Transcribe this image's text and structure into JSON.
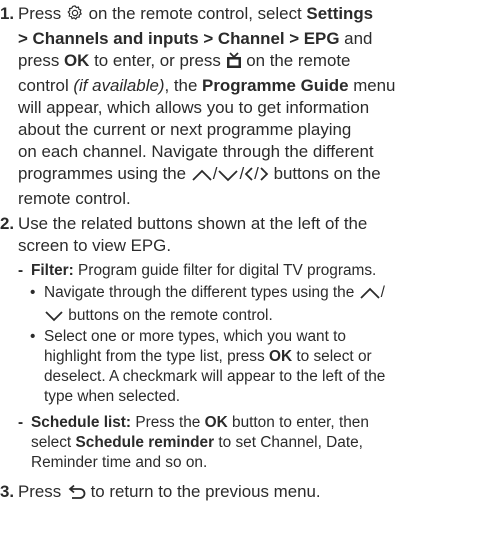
{
  "steps": [
    {
      "number": "1.",
      "lines": {
        "l1_a": "Press",
        "l1_b": "on the remote control, select",
        "l1_c": "Settings",
        "l2_a": "> Channels and inputs > Channel > EPG",
        "l2_b": "and",
        "l3_a": "press",
        "l3_b": "OK",
        "l3_c": "to enter, or press",
        "l3_d": "on the remote",
        "l4_a": "control",
        "l4_b": "(if available)",
        "l4_c": ", the",
        "l4_d": "Programme Guide",
        "l4_e": "menu",
        "l5": "will appear, which allows you to get information",
        "l6": "about the current or next programme playing",
        "l7": "on each channel. Navigate through the different",
        "l8_a": "programmes using the",
        "l8_b": "buttons on the",
        "l9": "remote control."
      }
    },
    {
      "number": "2.",
      "lines": {
        "l1": "Use the related buttons shown at the left of the",
        "l2": "screen to view EPG."
      },
      "filter": {
        "dash": "-",
        "label": "Filter:",
        "text": "Program guide filter for digital TV programs.",
        "bullets": {
          "b1_l1": "Navigate through the different types using the",
          "b1_l2": "buttons on the remote control.",
          "b2_l1": "Select one or more types, which you want to",
          "b2_l2_a": "highlight from the type list, press",
          "b2_l2_b": "OK",
          "b2_l2_c": "to select or",
          "b2_l3": "deselect. A checkmark will appear to the left of the",
          "b2_l4": "type when selected."
        },
        "bullet_char": "•"
      },
      "schedule": {
        "dash": "-",
        "label": "Schedule list:",
        "l1_a": "Press the",
        "l1_b": "OK",
        "l1_c": "button to enter, then",
        "l2_a": "select",
        "l2_b": "Schedule reminder",
        "l2_c": "to set Channel, Date,",
        "l3": "Reminder time and so on."
      }
    },
    {
      "number": "3.",
      "lines": {
        "l1_a": "Press",
        "l1_b": "to return to the previous menu."
      }
    }
  ],
  "icon_names": [
    "settings-gear-icon",
    "tv-guide-icon",
    "arrow-up-icon",
    "arrow-down-icon",
    "arrow-left-icon",
    "arrow-right-icon",
    "back-return-icon"
  ],
  "colors": {
    "text": "#2b2b2b",
    "background": "#ffffff"
  }
}
